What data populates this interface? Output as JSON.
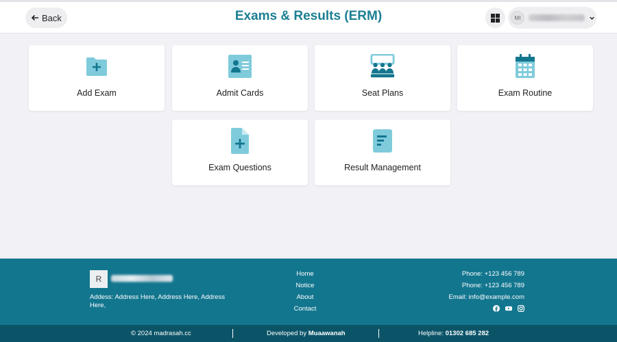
{
  "header": {
    "back_label": "Back",
    "title": "Exams & Results (ERM)",
    "user_initials": "MI"
  },
  "cards": [
    {
      "label": "Add Exam",
      "icon": "folder-add-icon"
    },
    {
      "label": "Admit Cards",
      "icon": "id-card-icon"
    },
    {
      "label": "Seat Plans",
      "icon": "seat-plan-icon"
    },
    {
      "label": "Exam Routine",
      "icon": "calendar-icon"
    },
    {
      "label": "Exam Questions",
      "icon": "file-add-icon"
    },
    {
      "label": "Result Management",
      "icon": "document-list-icon"
    }
  ],
  "footer": {
    "logo_letter": "R",
    "address": "Addess: Address Here, Address Here, Address Here,",
    "links": [
      "Home",
      "Notice",
      "About",
      "Contact"
    ],
    "phone1": "Phone: +123 456 789",
    "phone2": "Phone: +123 456 789",
    "email_label": "Email:",
    "email": "info@example.com",
    "social": [
      "facebook-icon",
      "youtube-icon",
      "instagram-icon"
    ]
  },
  "bottombar": {
    "copyright": "© 2024 madrasah.cc",
    "developed_label": "Developed by",
    "developer": "Muaawanah",
    "helpline_label": "Helpline:",
    "helpline": "01302 685 282"
  },
  "colors": {
    "accent": "#1b7f93",
    "icon_light": "#7fcbdc",
    "icon_dark": "#13768f",
    "footer_bg": "#13768f",
    "bottombar_bg": "#0b5468"
  }
}
